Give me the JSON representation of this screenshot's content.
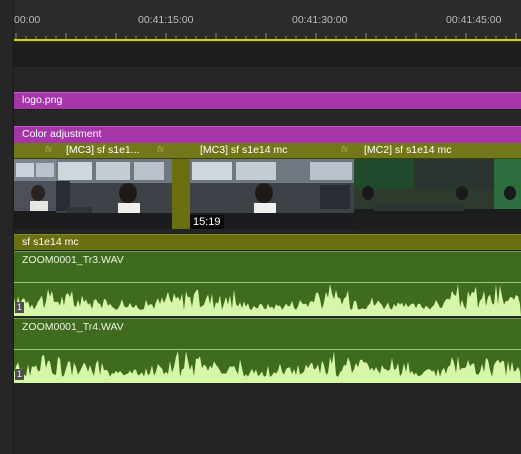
{
  "ruler": {
    "timecodes": [
      "00:00",
      "00:41:15:00",
      "00:41:30:00",
      "00:41:45:00"
    ]
  },
  "tracks": {
    "logo_clip": "logo.png",
    "adjustment_clip": "Color adjustment",
    "video_clips": [
      {
        "name": "",
        "fx": "fx"
      },
      {
        "name": "[MC3] sf s1e1...",
        "fx": "fx"
      },
      {
        "name": "",
        "fx": ""
      },
      {
        "name": "[MC3] sf s1e14 mc",
        "fx": "fx",
        "timecode": "15:19"
      },
      {
        "name": "[MC2] sf s1e14 mc",
        "fx": "fx"
      }
    ],
    "nested_sequence": "sf s1e14 mc",
    "audio_clips": [
      {
        "name": "ZOOM0001_Tr3.WAV",
        "channel": "1"
      },
      {
        "name": "ZOOM0001_Tr4.WAV",
        "channel": "1"
      }
    ]
  },
  "colors": {
    "background": "#232323",
    "playhead": "#d8d000",
    "graphic_clip": "#a535a8",
    "video_clip": "#6a7010",
    "audio_clip": "#3e6b1e",
    "waveform": "#d6f7a8"
  }
}
